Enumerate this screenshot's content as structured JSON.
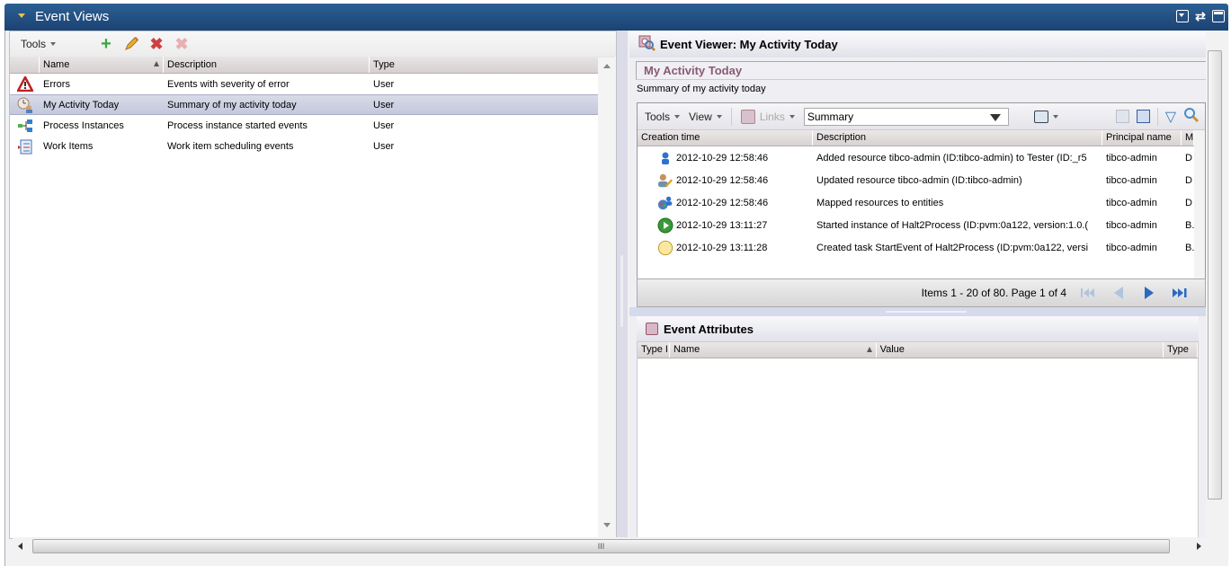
{
  "window": {
    "title": "Event Views",
    "title_icons": [
      "minimize-icon",
      "swap-icon",
      "maximize-icon"
    ]
  },
  "left_panel": {
    "toolbar": {
      "tools_label": "Tools",
      "icons": [
        "add-icon",
        "edit-icon",
        "delete-icon",
        "delete-disabled-icon"
      ]
    },
    "columns": [
      "Name",
      "Description",
      "Type"
    ],
    "rows": [
      {
        "icon": "error-icon",
        "name": "Errors",
        "description": "Events with severity of error",
        "type": "User",
        "selected": false
      },
      {
        "icon": "activity-clock-icon",
        "name": "My Activity Today",
        "description": "Summary of my activity today",
        "type": "User",
        "selected": true
      },
      {
        "icon": "process-icon",
        "name": "Process Instances",
        "description": "Process instance started events",
        "type": "User",
        "selected": false
      },
      {
        "icon": "work-items-icon",
        "name": "Work Items",
        "description": "Work item scheduling events",
        "type": "User",
        "selected": false
      }
    ]
  },
  "right_panel": {
    "header": "Event Viewer: My Activity Today",
    "section_title": "My Activity Today",
    "section_subtitle": "Summary of my activity today",
    "toolbar": {
      "tools_label": "Tools",
      "view_label": "View",
      "links_label": "Links",
      "select_value": "Summary"
    },
    "columns": [
      "Creation time",
      "Description",
      "Principal name",
      "M"
    ],
    "events": [
      {
        "icon": "resource-icon",
        "time": "2012-10-29 12:58:46",
        "description": "Added resource tibco-admin (ID:tibco-admin) to Tester (ID:_r5",
        "principal": "tibco-admin",
        "m": "D"
      },
      {
        "icon": "user-edit-icon",
        "time": "2012-10-29 12:58:46",
        "description": "Updated resource tibco-admin (ID:tibco-admin)",
        "principal": "tibco-admin",
        "m": "D"
      },
      {
        "icon": "mapping-icon",
        "time": "2012-10-29 12:58:46",
        "description": "Mapped resources to entities",
        "principal": "tibco-admin",
        "m": "D"
      },
      {
        "icon": "start-icon",
        "time": "2012-10-29 13:11:27",
        "description": "Started instance of Halt2Process (ID:pvm:0a122, version:1.0.(",
        "principal": "tibco-admin",
        "m": "B."
      },
      {
        "icon": "task-circle-icon",
        "time": "2012-10-29 13:11:28",
        "description": "Created task StartEvent of Halt2Process (ID:pvm:0a122, versi",
        "principal": "tibco-admin",
        "m": "B."
      }
    ],
    "pager": {
      "text": "Items 1 - 20 of 80. Page 1 of 4"
    },
    "attributes": {
      "header": "Event Attributes",
      "columns": [
        "Type I",
        "Name",
        "Value",
        "Type"
      ]
    }
  },
  "colors": {
    "title_bar": "#1f4b7e",
    "section_title": "#8a5a74",
    "selected_row": "#c9cde0"
  }
}
